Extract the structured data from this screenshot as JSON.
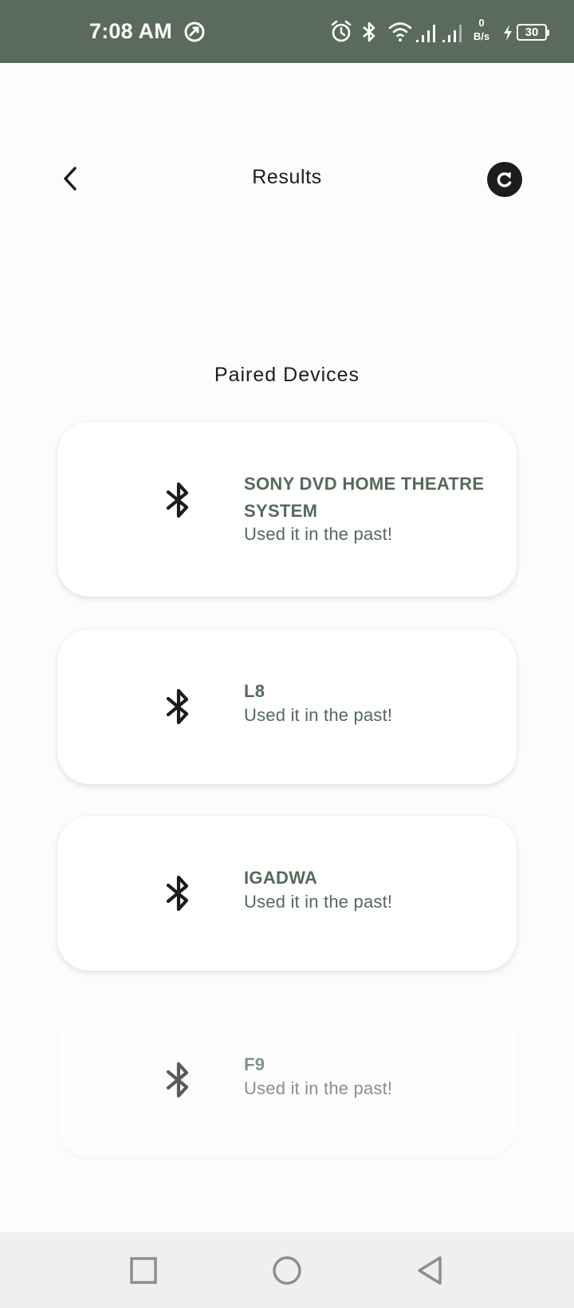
{
  "status_bar": {
    "time": "7:08 AM",
    "net_speed_value": "0",
    "net_speed_unit": "B/s",
    "battery": "30",
    "background_color": "#5a6b5c"
  },
  "header": {
    "title": "Results",
    "back_icon": "chevron-left-icon",
    "refresh_icon": "refresh-icon"
  },
  "section": {
    "title": "Paired Devices"
  },
  "devices": [
    {
      "name": "SONY DVD HOME THEATRE SYSTEM",
      "status": "Used it in the past!",
      "icon": "bluetooth-icon"
    },
    {
      "name": "L8",
      "status": "Used it in the past!",
      "icon": "bluetooth-icon"
    },
    {
      "name": "IGADWA",
      "status": "Used it in the past!",
      "icon": "bluetooth-icon"
    },
    {
      "name": "F9",
      "status": "Used it in the past!",
      "icon": "bluetooth-icon"
    }
  ],
  "nav": {
    "items": [
      "recent-apps-icon",
      "home-icon",
      "back-icon"
    ]
  },
  "colors": {
    "accent": "#556a58",
    "background": "#fefbfd",
    "text": "#1d1b1e"
  }
}
